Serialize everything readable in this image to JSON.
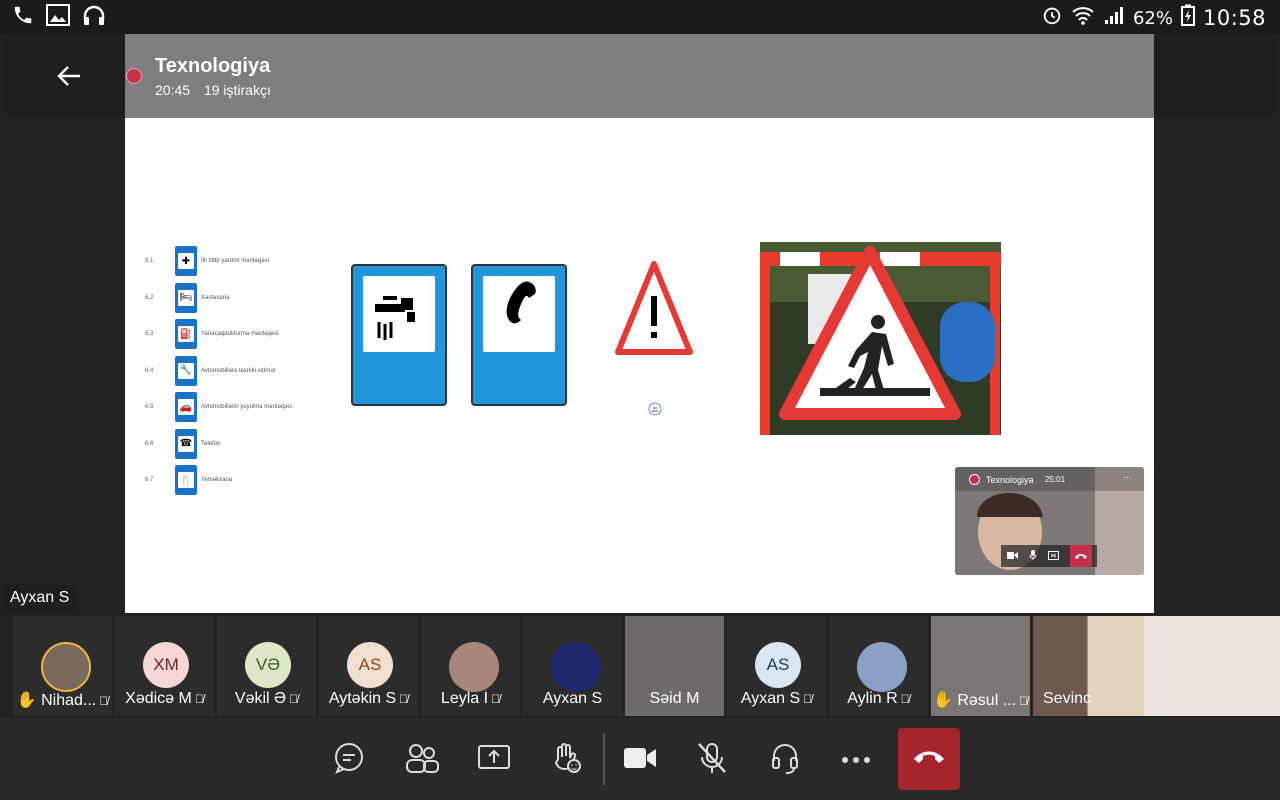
{
  "status_bar": {
    "battery": "62%",
    "time": "10:58"
  },
  "meeting": {
    "title": "Texnologiya",
    "duration": "20:45",
    "participants": "19 iştirakçı"
  },
  "slide": {
    "signs": [
      {
        "num": "6.1",
        "label": "İlk tibbi yardım məntəqəsi"
      },
      {
        "num": "6.2",
        "label": "Xəstəxana"
      },
      {
        "num": "6.3",
        "label": "Yanacaqdoldurma məntəqəsi"
      },
      {
        "num": "6.4",
        "label": "Avtomobillərə texniki xidmət"
      },
      {
        "num": "6.5",
        "label": "Avtomobillərin yuyulma məntəqəsi"
      },
      {
        "num": "6.6",
        "label": "Telefon"
      },
      {
        "num": "6.7",
        "label": "Yeməkxana"
      }
    ]
  },
  "self_preview": {
    "title": "Texnologiya",
    "time": "25:01"
  },
  "active_speaker": "Ayxan S",
  "participants": [
    {
      "name": "✋ Nihad...",
      "initials": "",
      "muted": true
    },
    {
      "name": "Xədicə M",
      "initials": "XM",
      "muted": true
    },
    {
      "name": "Vəkil Ə",
      "initials": "VƏ",
      "muted": true
    },
    {
      "name": "Aytəkin S",
      "initials": "AS",
      "muted": true
    },
    {
      "name": "Leyla İ",
      "initials": "",
      "muted": true
    },
    {
      "name": "Ayxan S",
      "initials": "",
      "muted": false
    },
    {
      "name": "Səid M",
      "initials": "",
      "muted": false
    },
    {
      "name": "Ayxan S",
      "initials": "AS",
      "muted": true
    },
    {
      "name": "Aylin R",
      "initials": "",
      "muted": true
    },
    {
      "name": "✋ Rəsul ...",
      "initials": "",
      "muted": true
    },
    {
      "name": "Sevinc",
      "initials": "",
      "muted": false
    }
  ],
  "colors": {
    "accent_red": "#c4314b",
    "hangup": "#a4262c",
    "sign_blue": "#1a73c9",
    "hand_raised_border": "#f2b53c"
  }
}
